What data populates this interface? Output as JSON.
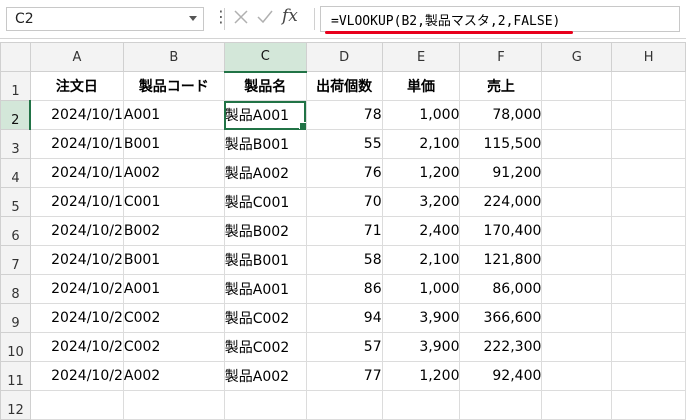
{
  "name_box": {
    "value": "C2"
  },
  "formula_bar": {
    "more_icon": "vertical-ellipsis",
    "cancel_icon": "x-mark",
    "enter_icon": "check-mark",
    "fx_label": "fx",
    "formula": "=VLOOKUP(B2,製品マスタ,2,FALSE)",
    "underline_color": "#e8001c"
  },
  "columns": [
    "A",
    "B",
    "C",
    "D",
    "E",
    "F",
    "G",
    "H"
  ],
  "active_column": "C",
  "active_row": 2,
  "row_numbers": [
    "1",
    "2",
    "3",
    "4",
    "5",
    "6",
    "7",
    "8",
    "9",
    "10",
    "11",
    "12"
  ],
  "headers": [
    "注文日",
    "製品コード",
    "製品名",
    "出荷個数",
    "単価",
    "売上"
  ],
  "rows": [
    [
      "2024/10/1",
      "A001",
      "製品A001",
      "78",
      "1,000",
      "78,000"
    ],
    [
      "2024/10/1",
      "B001",
      "製品B001",
      "55",
      "2,100",
      "115,500"
    ],
    [
      "2024/10/1",
      "A002",
      "製品A002",
      "76",
      "1,200",
      "91,200"
    ],
    [
      "2024/10/1",
      "C001",
      "製品C001",
      "70",
      "3,200",
      "224,000"
    ],
    [
      "2024/10/2",
      "B002",
      "製品B002",
      "71",
      "2,400",
      "170,400"
    ],
    [
      "2024/10/2",
      "B001",
      "製品B001",
      "58",
      "2,100",
      "121,800"
    ],
    [
      "2024/10/2",
      "A001",
      "製品A001",
      "86",
      "1,000",
      "86,000"
    ],
    [
      "2024/10/2",
      "C002",
      "製品C002",
      "94",
      "3,900",
      "366,600"
    ],
    [
      "2024/10/2",
      "C002",
      "製品C002",
      "57",
      "3,900",
      "222,300"
    ],
    [
      "2024/10/2",
      "A002",
      "製品A002",
      "77",
      "1,200",
      "92,400"
    ]
  ],
  "accent_color": "#217346"
}
